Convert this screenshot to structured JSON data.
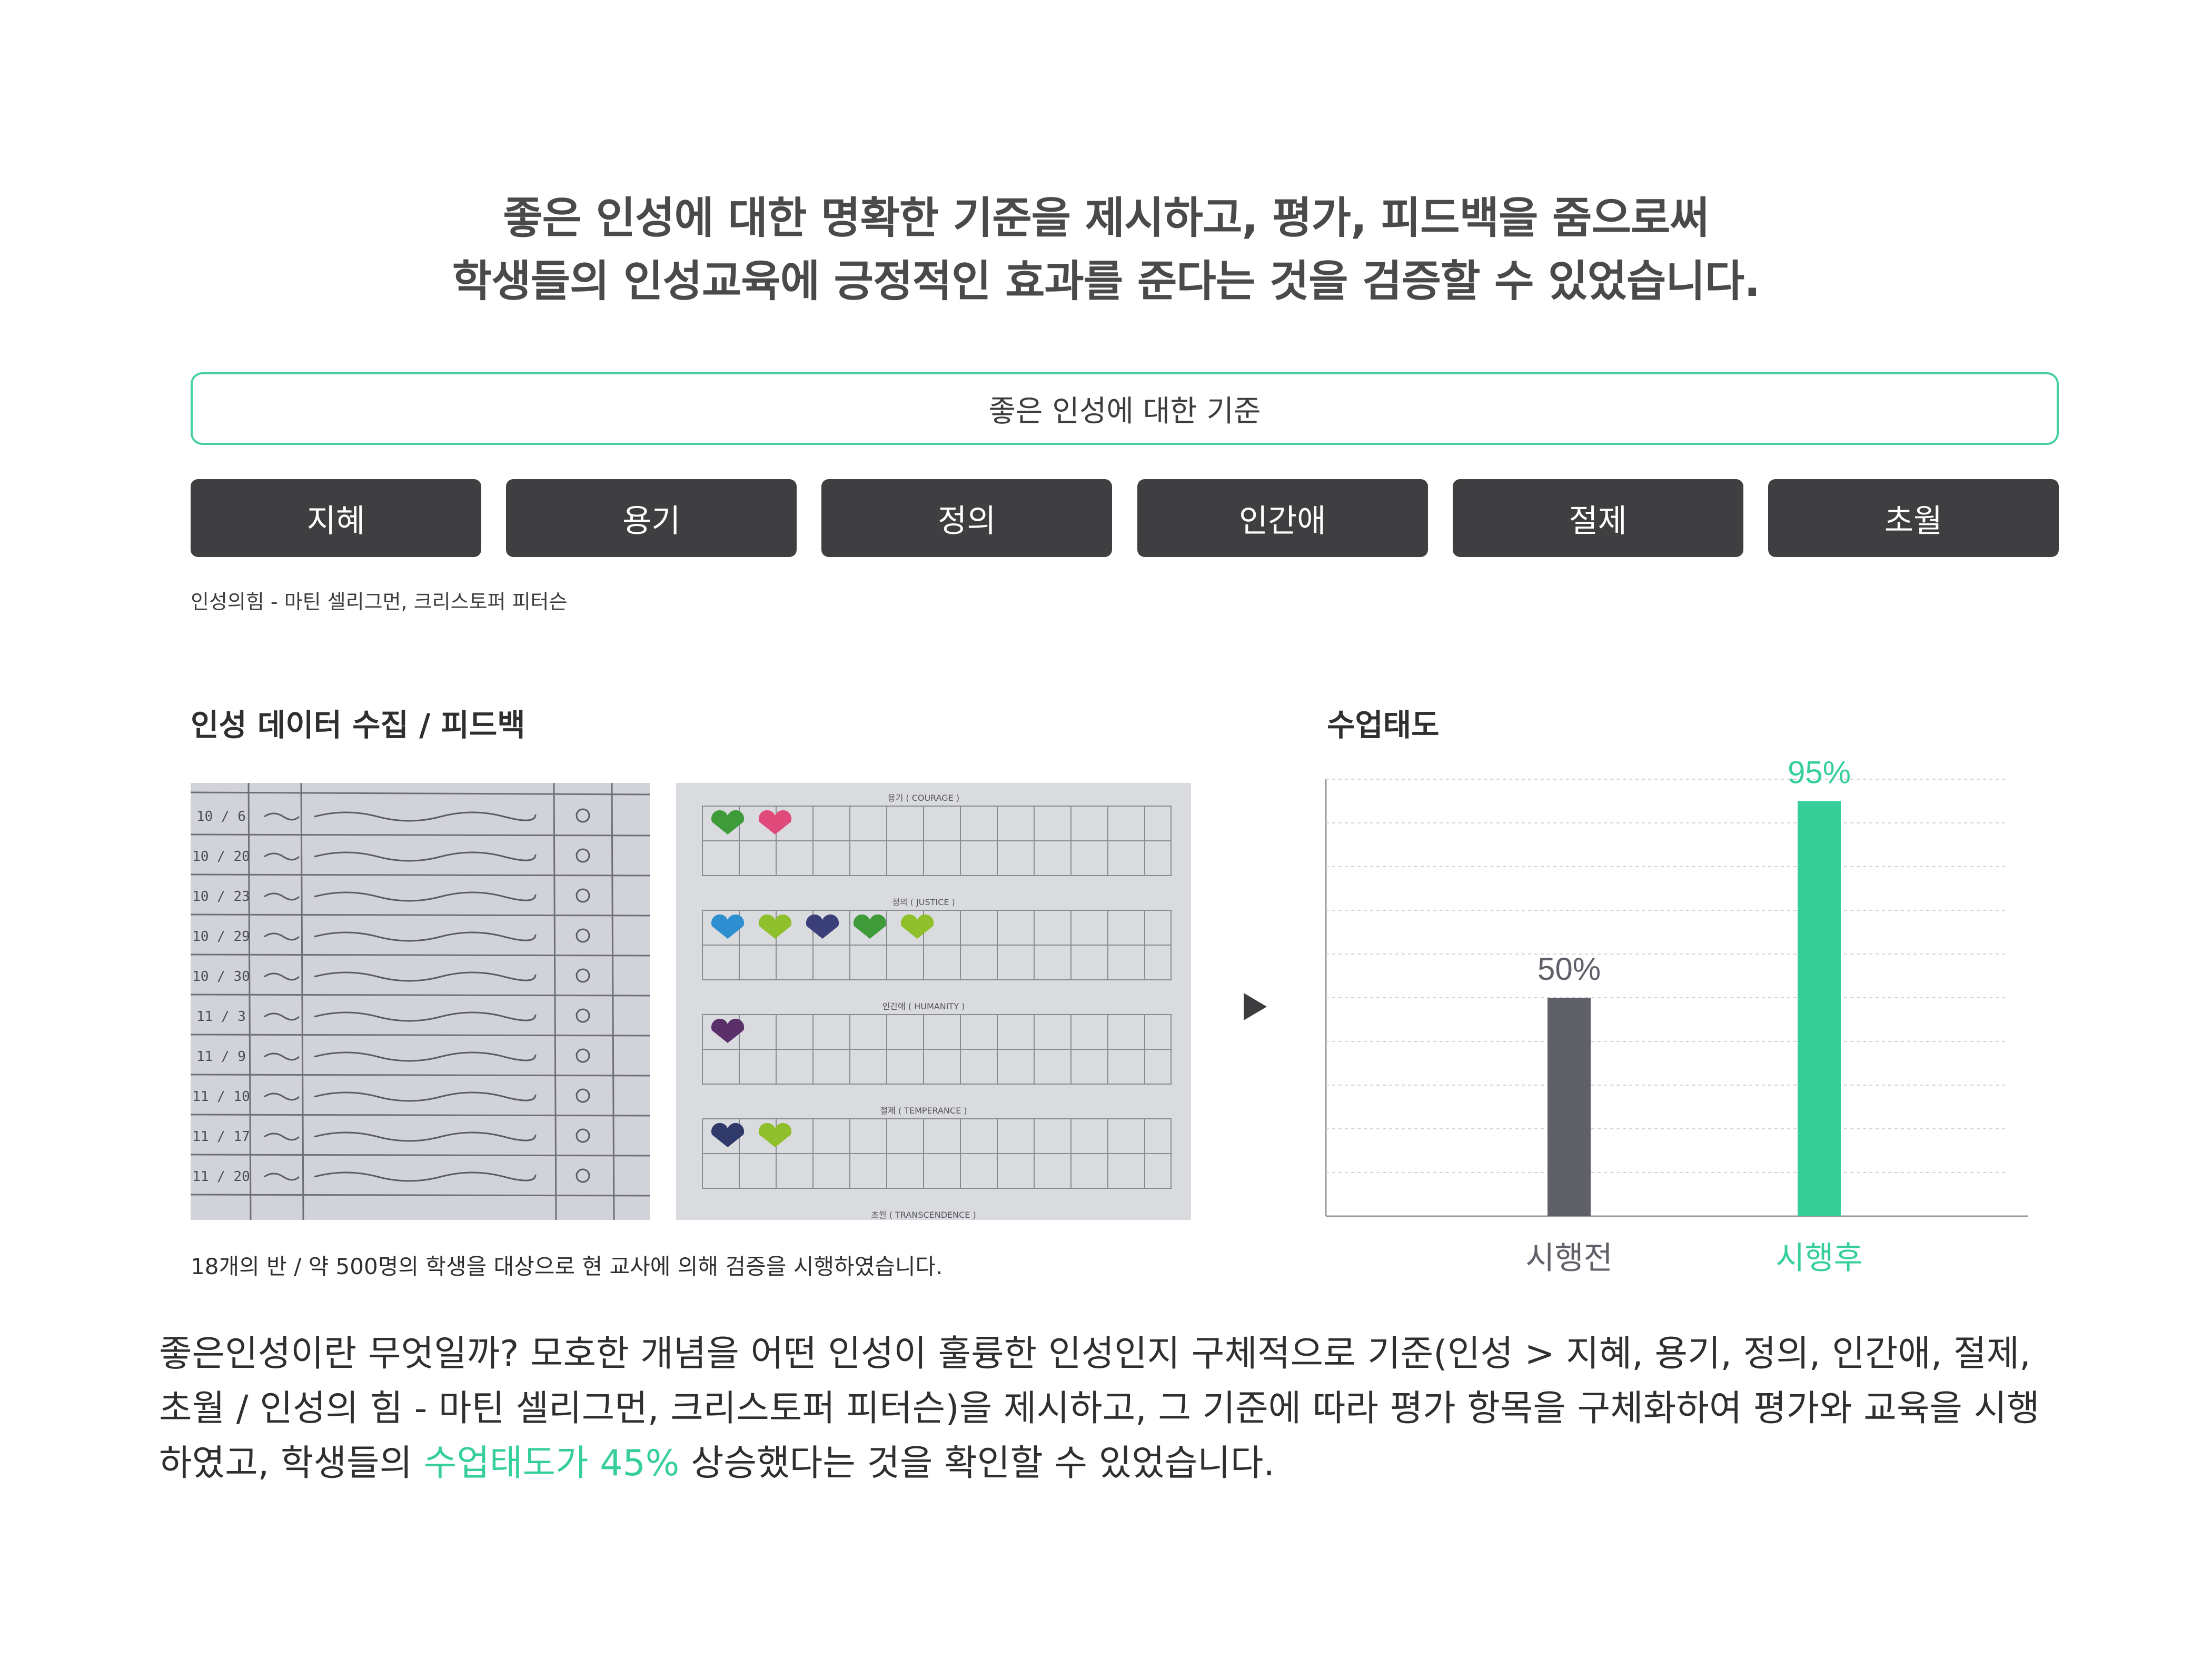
{
  "headline": {
    "line1": "좋은 인성에 대한 명확한 기준을 제시하고, 평가, 피드백을 줌으로써",
    "line2": "학생들의 인성교육에 긍정적인 효과를 준다는 것을 검증할 수 있었습니다."
  },
  "criteria": {
    "title": "좋은 인성에 대한 기준",
    "virtues": [
      "지혜",
      "용기",
      "정의",
      "인간애",
      "절제",
      "초월"
    ],
    "source": "인성의힘 - 마틴 셀리그먼, 크리스토퍼 피터슨"
  },
  "data_section": {
    "title": "인성 데이터 수집 / 피드백",
    "caption": "18개의 반 / 약 500명의 학생을 대상으로 현 교사에 의해 검증을 시행하였습니다.",
    "diary_dates": [
      "10 / 6",
      "10 / 20",
      "10 / 23",
      "10 / 29",
      "10 / 30",
      "11 / 3",
      "11 / 9",
      "11 / 10",
      "11 / 17",
      "11 / 20"
    ],
    "sticker_sections": [
      "용기 ( COURAGE )",
      "정의 ( JUSTICE )",
      "인간애 ( HUMANITY )",
      "절제 ( TEMPERANCE )",
      "초월 ( TRANSCENDENCE )"
    ]
  },
  "chart_section": {
    "title": "수업태도"
  },
  "chart_data": {
    "type": "bar",
    "categories": [
      "시행전",
      "시행후"
    ],
    "values": [
      50,
      95
    ],
    "value_labels": [
      "50%",
      "95%"
    ],
    "ylim": [
      0,
      100
    ],
    "colors": [
      "#5f6068",
      "#36cf9a"
    ],
    "grid": true,
    "title": "",
    "xlabel": "",
    "ylabel": ""
  },
  "body": {
    "part1": "좋은인성이란 무엇일까? 모호한 개념을 어떤 인성이 훌륭한 인성인지 구체적으로 기준(인성 > 지혜, 용기, 정의, 인간애, 절제, 초월 / 인성의 힘 - 마틴 셀리그먼, 크리스토퍼 피터슨)을 제시하고, 그 기준에 따라 평가 항목을 구체화하여 평가와 교육을 시행하였고, 학생들의 ",
    "highlight": "수업태도가 45%",
    "part2": " 상승했다는 것을 확인할 수 있었습니다."
  },
  "colors": {
    "accent": "#36cf9a",
    "button": "#3f3f41",
    "bar_before": "#5f6068"
  }
}
